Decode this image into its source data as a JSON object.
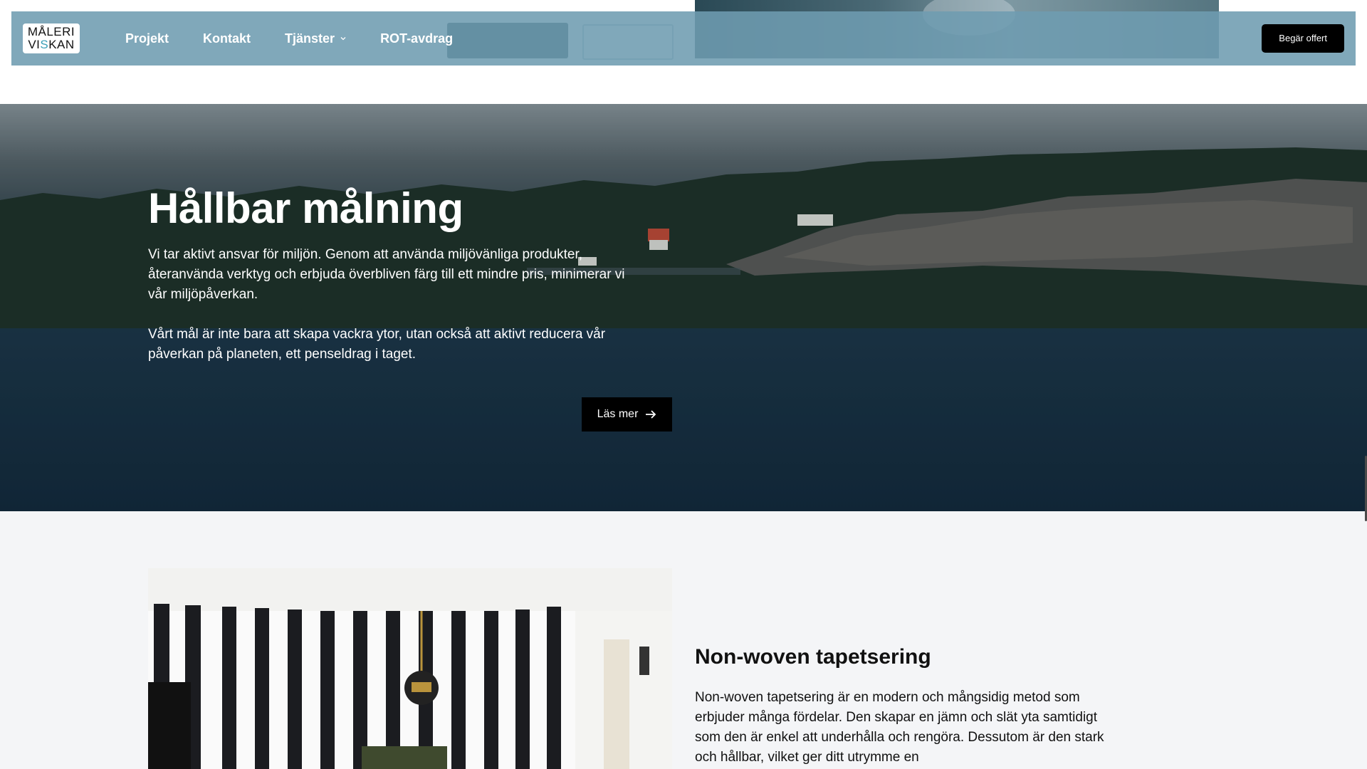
{
  "header": {
    "logo": {
      "line1": "MÅLERI",
      "line2a": "VI",
      "line2b": "S",
      "line2c": "KAN"
    },
    "nav": [
      {
        "label": "Projekt"
      },
      {
        "label": "Kontakt"
      },
      {
        "label": "Tjänster",
        "has_dropdown": true
      },
      {
        "label": "ROT-avdrag"
      }
    ],
    "cta_label": "Begär offert"
  },
  "hero": {
    "title": "Hållbar målning",
    "paragraph1": "Vi tar aktivt ansvar för miljön. Genom att använda miljövänliga produkter, återanvända verktyg och erbjuda överbliven färg till ett mindre pris, minimerar vi vår miljöpåverkan.",
    "paragraph2": "Vårt mål är inte bara att skapa vackra ytor, utan också att aktivt reducera vår påverkan på planeten, ett penseldrag i taget.",
    "button_label": "Läs mer",
    "button_icon": "arrow-right-icon"
  },
  "service": {
    "title": "Non-woven tapetsering",
    "text": "Non-woven tapetsering är en modern och mångsidig metod som erbjuder många fördelar. Den skapar en jämn och slät yta samtidigt som den är enkel att underhålla och rengöra. Dessutom är den stark och hållbar, vilket ger ditt utrymme en"
  },
  "colors": {
    "header_bg": "#6e9cb0",
    "cta_bg": "#000000",
    "section_bg": "#f4f5f7"
  }
}
